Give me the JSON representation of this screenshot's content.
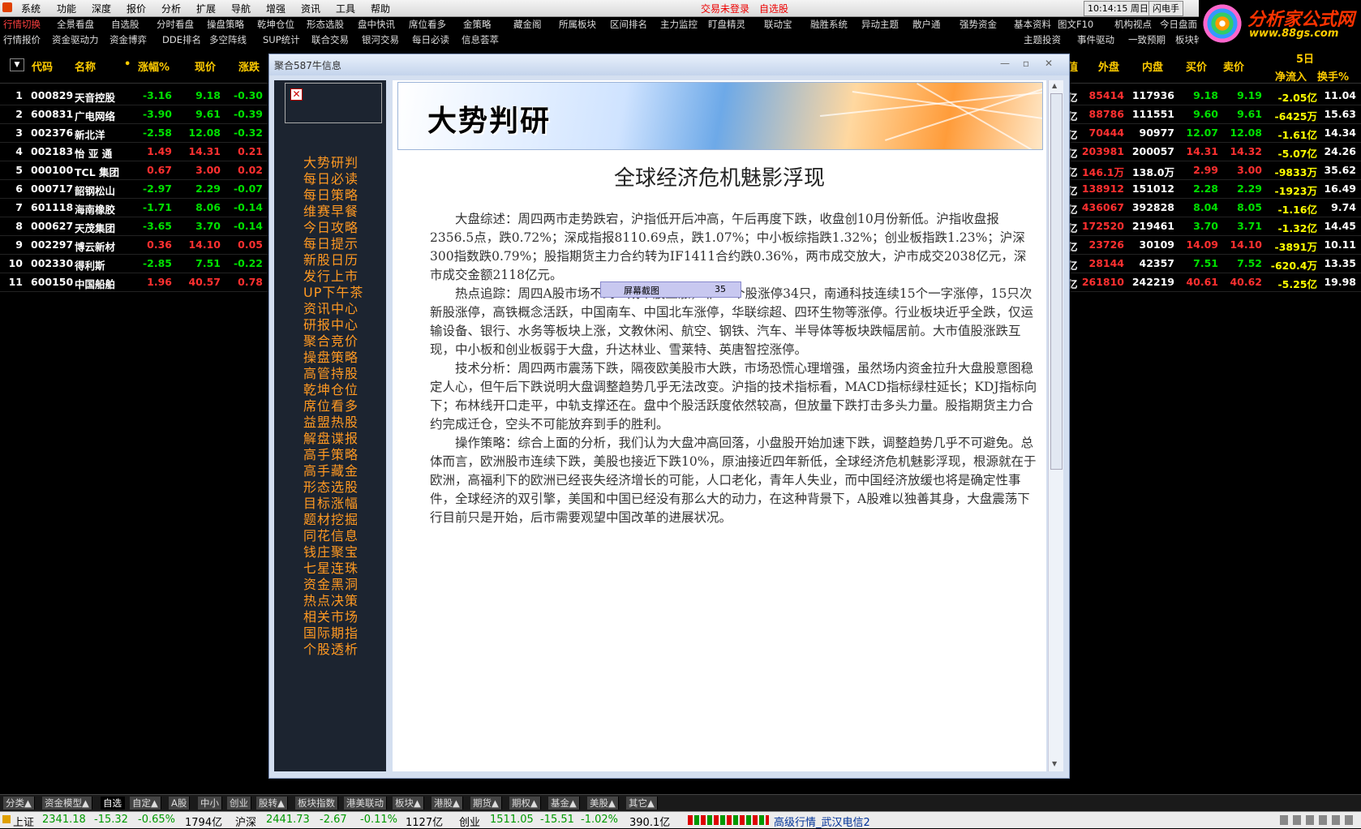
{
  "menu": {
    "items": [
      "系统",
      "功能",
      "深度",
      "报价",
      "分析",
      "扩展",
      "导航",
      "增强",
      "资讯",
      "工具",
      "帮助"
    ],
    "status_login": "交易未登录",
    "status_self": "自选股",
    "clock": "10:14:15 周日",
    "flash": "闪电手"
  },
  "toolbar1": [
    "行情切换",
    "全景看盘",
    "自选股",
    "分时看盘",
    "操盘策略",
    "乾坤仓位",
    "形态选股",
    "盘中快讯",
    "席位看多",
    "金策略",
    "藏金阁",
    "所属板块",
    "区间排名",
    "主力监控",
    "盯盘精灵",
    "联动宝",
    "融胜系统",
    "异动主题",
    "散户通",
    "强势资金",
    "基本资料",
    "图文F10",
    "机构视点",
    "今日盘面"
  ],
  "toolbar2": [
    "行情报价",
    "资金驱动力",
    "资金博弈",
    "DDE排名",
    "多空阵线",
    "SUP统计",
    "联合交易",
    "银河交易",
    "每日必读",
    "信息荟萃",
    "主题投资",
    "事件驱动",
    "一致预期",
    "板块轮动"
  ],
  "logo": {
    "title": "分析家公式网",
    "url": "www.88gs.com"
  },
  "header": {
    "left": [
      "代码",
      "名称",
      "•",
      "涨幅%",
      "现价",
      "涨跌"
    ],
    "right": [
      "值",
      "外盘",
      "内盘",
      "买价",
      "卖价"
    ],
    "days": "5日",
    "net": "净流入",
    "turnover": "换手%"
  },
  "rows": [
    {
      "n": "1",
      "code": "000829",
      "name": "天音控股",
      "pct": "-3.16",
      "price": "9.18",
      "chg": "-0.30",
      "val": "亿",
      "outer": "85414",
      "inner": "117936",
      "bid": "9.18",
      "ask": "9.19",
      "flow": "-2.05亿",
      "turn": "11.04"
    },
    {
      "n": "2",
      "code": "600831",
      "name": "广电网络",
      "pct": "-3.90",
      "price": "9.61",
      "chg": "-0.39",
      "val": "亿",
      "outer": "88786",
      "inner": "111551",
      "bid": "9.60",
      "ask": "9.61",
      "flow": "-6425万",
      "turn": "15.63"
    },
    {
      "n": "3",
      "code": "002376",
      "name": "新北洋",
      "pct": "-2.58",
      "price": "12.08",
      "chg": "-0.32",
      "val": "亿",
      "outer": "70444",
      "inner": "90977",
      "bid": "12.07",
      "ask": "12.08",
      "flow": "-1.61亿",
      "turn": "14.34"
    },
    {
      "n": "4",
      "code": "002183",
      "name": "怡 亚 通",
      "pct": "1.49",
      "price": "14.31",
      "chg": "0.21",
      "val": "亿",
      "outer": "203981",
      "inner": "200057",
      "bid": "14.31",
      "ask": "14.32",
      "flow": "-5.07亿",
      "turn": "24.26"
    },
    {
      "n": "5",
      "code": "000100",
      "name": "TCL 集团",
      "pct": "0.67",
      "price": "3.00",
      "chg": "0.02",
      "val": "亿",
      "outer": "146.1万",
      "inner": "138.0万",
      "bid": "2.99",
      "ask": "3.00",
      "flow": "-9833万",
      "turn": "35.62"
    },
    {
      "n": "6",
      "code": "000717",
      "name": "韶钢松山",
      "pct": "-2.97",
      "price": "2.29",
      "chg": "-0.07",
      "val": "亿",
      "outer": "138912",
      "inner": "151012",
      "bid": "2.28",
      "ask": "2.29",
      "flow": "-1923万",
      "turn": "16.49"
    },
    {
      "n": "7",
      "code": "601118",
      "name": "海南橡胶",
      "pct": "-1.71",
      "price": "8.06",
      "chg": "-0.14",
      "val": "亿",
      "outer": "436067",
      "inner": "392828",
      "bid": "8.04",
      "ask": "8.05",
      "flow": "-1.16亿",
      "turn": "9.74"
    },
    {
      "n": "8",
      "code": "000627",
      "name": "天茂集团",
      "pct": "-3.65",
      "price": "3.70",
      "chg": "-0.14",
      "val": "亿",
      "outer": "172520",
      "inner": "219461",
      "bid": "3.70",
      "ask": "3.71",
      "flow": "-1.32亿",
      "turn": "14.45"
    },
    {
      "n": "9",
      "code": "002297",
      "name": "博云新材",
      "pct": "0.36",
      "price": "14.10",
      "chg": "0.05",
      "val": "亿",
      "outer": "23726",
      "inner": "30109",
      "bid": "14.09",
      "ask": "14.10",
      "flow": "-3891万",
      "turn": "10.11"
    },
    {
      "n": "10",
      "code": "002330",
      "name": "得利斯",
      "pct": "-2.85",
      "price": "7.51",
      "chg": "-0.22",
      "val": "亿",
      "outer": "28144",
      "inner": "42357",
      "bid": "7.51",
      "ask": "7.52",
      "flow": "-620.4万",
      "turn": "13.35"
    },
    {
      "n": "11",
      "code": "600150",
      "name": "中国船舶",
      "pct": "1.96",
      "price": "40.57",
      "chg": "0.78",
      "val": "亿",
      "outer": "261810",
      "inner": "242219",
      "bid": "40.61",
      "ask": "40.62",
      "flow": "-5.25亿",
      "turn": "19.98"
    }
  ],
  "dialog": {
    "title": "聚合587牛信息",
    "nav": [
      "大势研判",
      "每日必读",
      "每日策略",
      "维赛早餐",
      "今日攻略",
      "每日提示",
      "新股日历",
      "发行上市",
      "UP下午茶",
      "资讯中心",
      "研报中心",
      "聚合竞价",
      "操盘策略",
      "高管持股",
      "乾坤仓位",
      "席位看多",
      "益盟热股",
      "解盘谍报",
      "高手策略",
      "高手藏金",
      "形态选股",
      "目标涨幅",
      "题材挖掘",
      "同花信息",
      "钱庄聚宝",
      "七星连珠",
      "资金黑洞",
      "热点决策",
      "相关市场",
      "国际期指",
      "个股透析"
    ],
    "tooltip_label": "屏幕截图",
    "tooltip_value": "35",
    "banner": "大势判研",
    "article_title": "全球经济危机魅影浮现",
    "paragraphs": [
      "大盘综述：周四两市走势跌宕，沪指低开后冲高，午后再度下跌，收盘创10月份新低。沪指收盘报2356.5点，跌0.72%；深成指报8110.69点，跌1.07%；中小板综指跌1.32%；创业板指跌1.23%；沪深300指数跌0.79%；股指期货主力合约转为IF1411合约跌0.36%，两市成交放大，沪市成交2038亿元，深市成交金额2118亿元。",
      "热点追踪：周四A股市场不到二成个股上涨，非ST个股涨停34只，南通科技连续15个一字涨停，15只次新股涨停，高铁概念活跃，中国南车、中国北车涨停，华联综超、四环生物等涨停。行业板块近乎全跌，仅运输设备、银行、水务等板块上涨，文教休闲、航空、钢铁、汽车、半导体等板块跌幅居前。大市值股涨跌互现，中小板和创业板弱于大盘，升达林业、雪莱特、英唐智控涨停。",
      "技术分析：周四两市震荡下跌，隔夜欧美股市大跌，市场恐慌心理增强，虽然场内资金拉升大盘股意图稳定人心，但午后下跌说明大盘调整趋势几乎无法改变。沪指的技术指标看，MACD指标绿柱延长；KDJ指标向下；布林线开口走平，中轨支撑还在。盘中个股活跃度依然较高，但放量下跌打击多头力量。股指期货主力合约完成迁仓，空头不可能放弃到手的胜利。",
      "操作策略：综合上面的分析，我们认为大盘冲高回落，小盘股开始加速下跌，调整趋势几乎不可避免。总体而言，欧洲股市连续下跌，美股也接近下跌10%，原油接近四年新低，全球经济危机魅影浮现，根源就在于欧洲，高福利下的欧洲已经丧失经济增长的可能，人口老化，青年人失业，而中国经济放缓也将是确定性事件，全球经济的双引擎，美国和中国已经没有那么大的动力，在这种背景下，A股难以独善其身，大盘震荡下行目前只是开始，后市需要观望中国改革的进展状况。"
    ]
  },
  "tabs": [
    "分类▲",
    "资金模型▲",
    "自选",
    "自定▲",
    "A股",
    "中小",
    "创业",
    "股转▲",
    "板块指数",
    "港美联动",
    "板块▲",
    "港股▲",
    "期货▲",
    "期权▲",
    "基金▲",
    "美股▲",
    "其它▲"
  ],
  "status": {
    "sh_label": "上证",
    "sh_val": "2341.18",
    "sh_chg": "-15.32",
    "sh_pct": "-0.65%",
    "sh_vol": "1794亿",
    "hs_label": "沪深",
    "hs_val": "2441.73",
    "hs_chg": "-2.67",
    "hs_pct": "-0.11%",
    "hs_vol": "1127亿",
    "cy_label": "创业",
    "cy_val": "1511.05",
    "cy_chg": "-15.51",
    "cy_pct": "-1.02%",
    "cy_vol": "390.1亿",
    "server": "高级行情_武汉电信2"
  }
}
